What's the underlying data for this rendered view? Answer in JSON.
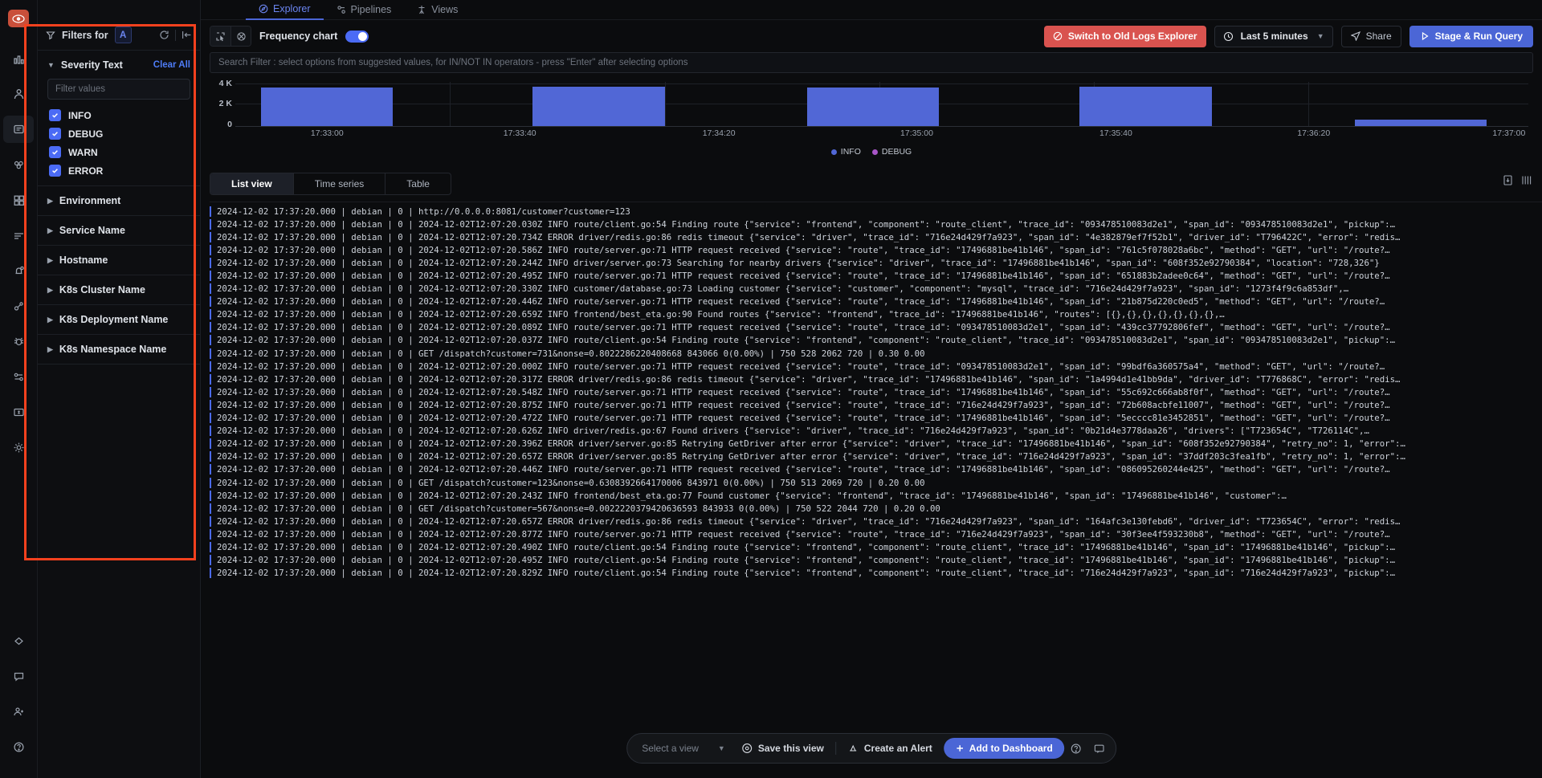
{
  "rail": {
    "logo": "signoz-logo-icon",
    "items": [
      {
        "name": "bar-chart-icon",
        "active": false
      },
      {
        "name": "traces-icon",
        "active": false
      },
      {
        "name": "logs-icon",
        "active": true
      },
      {
        "name": "services-icon",
        "active": false
      },
      {
        "name": "dashboards-icon",
        "active": false
      },
      {
        "name": "list-icon",
        "active": false
      },
      {
        "name": "alerts-bell-icon",
        "active": false
      },
      {
        "name": "exceptions-icon",
        "active": false
      },
      {
        "name": "bug-icon",
        "active": false
      },
      {
        "name": "pipelines-icon",
        "active": false
      },
      {
        "name": "billing-icon",
        "active": false
      },
      {
        "name": "settings-gear-icon",
        "active": false
      }
    ],
    "bottom_items": [
      {
        "name": "integrations-icon"
      },
      {
        "name": "support-chat-icon"
      },
      {
        "name": "invite-members-icon"
      },
      {
        "name": "help-icon"
      }
    ]
  },
  "top_tabs": [
    {
      "label": "Explorer",
      "icon": "compass-icon",
      "selected": true
    },
    {
      "label": "Pipelines",
      "icon": "pipelines-icon",
      "selected": false
    },
    {
      "label": "Views",
      "icon": "views-icon",
      "selected": false
    }
  ],
  "filters": {
    "title": "Filters for",
    "chip": "A",
    "sync_icon": "refresh-icon",
    "collapse_icon": "collapse-panel-icon",
    "sections": [
      {
        "label": "Severity Text",
        "expanded": true,
        "clear_all": "Clear All",
        "input_placeholder": "Filter values",
        "options": [
          {
            "label": "INFO",
            "checked": true
          },
          {
            "label": "DEBUG",
            "checked": true
          },
          {
            "label": "WARN",
            "checked": true
          },
          {
            "label": "ERROR",
            "checked": true
          }
        ]
      },
      {
        "label": "Environment",
        "expanded": false
      },
      {
        "label": "Service Name",
        "expanded": false
      },
      {
        "label": "Hostname",
        "expanded": false
      },
      {
        "label": "K8s Cluster Name",
        "expanded": false
      },
      {
        "label": "K8s Deployment Name",
        "expanded": false
      },
      {
        "label": "K8s Namespace Name",
        "expanded": false
      }
    ]
  },
  "toolbar": {
    "select_icon": "cursor-select-icon",
    "lasso_icon": "lasso-select-icon",
    "frequency_label": "Frequency chart",
    "frequency_on": true,
    "switch_old": "Switch to Old Logs Explorer",
    "switch_old_icon": "slash-circle-icon",
    "time_range": "Last 5 minutes",
    "time_icon": "clock-icon",
    "share": "Share",
    "share_icon": "send-icon",
    "run_query": "Stage & Run Query",
    "run_icon": "play-icon",
    "accent_blue": "#4b66d6",
    "danger_red": "#d9534f"
  },
  "search": {
    "placeholder": "Search Filter : select options from suggested values, for IN/NOT IN operators - press \"Enter\" after selecting options"
  },
  "chart_data": {
    "type": "bar",
    "title": "",
    "xlabel": "",
    "ylabel": "",
    "ylim": [
      0,
      4000
    ],
    "yticks": [
      "0",
      "2 K",
      "4 K"
    ],
    "ytick_values": [
      0,
      2000,
      4000
    ],
    "grid": true,
    "legend_position": "bottom",
    "xticks": [
      "17:33:00",
      "17:33:40",
      "17:34:20",
      "17:35:00",
      "17:35:40",
      "17:36:20",
      "17:37:00"
    ],
    "series": [
      {
        "name": "INFO",
        "color": "#5167d6",
        "bars": [
          {
            "x": "17:33:00",
            "value": 3400
          },
          {
            "x": "17:33:40",
            "value": 3450
          },
          {
            "x": "17:34:40",
            "value": 3400
          },
          {
            "x": "17:35:40",
            "value": 3450
          },
          {
            "x": "17:36:50",
            "value": 500
          }
        ]
      },
      {
        "name": "DEBUG",
        "color": "#a855c7",
        "bars": []
      }
    ],
    "legend": [
      {
        "label": "INFO",
        "color": "#5167d6"
      },
      {
        "label": "DEBUG",
        "color": "#a855c7"
      }
    ]
  },
  "view_tabs": [
    {
      "label": "List view",
      "selected": true
    },
    {
      "label": "Time series",
      "selected": false
    },
    {
      "label": "Table",
      "selected": false
    }
  ],
  "view_actions": [
    {
      "name": "download-icon"
    },
    {
      "name": "column-settings-icon"
    }
  ],
  "logs": [
    "2024-12-02 17:37:20.000 | debian | 0 | http://0.0.0.0:8081/customer?customer=123",
    "2024-12-02 17:37:20.000 | debian | 0 | 2024-12-02T12:07:20.030Z INFO route/client.go:54 Finding route {\"service\": \"frontend\", \"component\": \"route_client\", \"trace_id\": \"093478510083d2e1\", \"span_id\": \"093478510083d2e1\", \"pickup\":…",
    "2024-12-02 17:37:20.000 | debian | 0 | 2024-12-02T12:07:20.734Z ERROR driver/redis.go:86 redis timeout {\"service\": \"driver\", \"trace_id\": \"716e24d429f7a923\", \"span_id\": \"4e382879ef7f52b1\", \"driver_id\": \"T796422C\", \"error\": \"redis…",
    "2024-12-02 17:37:20.000 | debian | 0 | 2024-12-02T12:07:20.586Z INFO route/server.go:71 HTTP request received {\"service\": \"route\", \"trace_id\": \"17496881be41b146\", \"span_id\": \"761c5f078028a6bc\", \"method\": \"GET\", \"url\": \"/route?…",
    "2024-12-02 17:37:20.000 | debian | 0 | 2024-12-02T12:07:20.244Z INFO driver/server.go:73 Searching for nearby drivers {\"service\": \"driver\", \"trace_id\": \"17496881be41b146\", \"span_id\": \"608f352e92790384\", \"location\": \"728,326\"}",
    "2024-12-02 17:37:20.000 | debian | 0 | 2024-12-02T12:07:20.495Z INFO route/server.go:71 HTTP request received {\"service\": \"route\", \"trace_id\": \"17496881be41b146\", \"span_id\": \"651883b2adee0c64\", \"method\": \"GET\", \"url\": \"/route?…",
    "2024-12-02 17:37:20.000 | debian | 0 | 2024-12-02T12:07:20.330Z INFO customer/database.go:73 Loading customer {\"service\": \"customer\", \"component\": \"mysql\", \"trace_id\": \"716e24d429f7a923\", \"span_id\": \"1273f4f9c6a853df\",…",
    "2024-12-02 17:37:20.000 | debian | 0 | 2024-12-02T12:07:20.446Z INFO route/server.go:71 HTTP request received {\"service\": \"route\", \"trace_id\": \"17496881be41b146\", \"span_id\": \"21b875d220c0ed5\", \"method\": \"GET\", \"url\": \"/route?…",
    "2024-12-02 17:37:20.000 | debian | 0 | 2024-12-02T12:07:20.659Z INFO frontend/best_eta.go:90 Found routes {\"service\": \"frontend\", \"trace_id\": \"17496881be41b146\", \"routes\": [{},{},{},{},{},{},{},…",
    "2024-12-02 17:37:20.000 | debian | 0 | 2024-12-02T12:07:20.089Z INFO route/server.go:71 HTTP request received {\"service\": \"route\", \"trace_id\": \"093478510083d2e1\", \"span_id\": \"439cc37792806fef\", \"method\": \"GET\", \"url\": \"/route?…",
    "2024-12-02 17:37:20.000 | debian | 0 | 2024-12-02T12:07:20.037Z INFO route/client.go:54 Finding route {\"service\": \"frontend\", \"component\": \"route_client\", \"trace_id\": \"093478510083d2e1\", \"span_id\": \"093478510083d2e1\", \"pickup\":…",
    "2024-12-02 17:37:20.000 | debian | 0 | GET /dispatch?customer=731&nonse=0.8022286220408668 843066 0(0.00%) | 750 528 2062 720 | 0.30 0.00",
    "2024-12-02 17:37:20.000 | debian | 0 | 2024-12-02T12:07:20.000Z INFO route/server.go:71 HTTP request received {\"service\": \"route\", \"trace_id\": \"093478510083d2e1\", \"span_id\": \"99bdf6a360575a4\", \"method\": \"GET\", \"url\": \"/route?…",
    "2024-12-02 17:37:20.000 | debian | 0 | 2024-12-02T12:07:20.317Z ERROR driver/redis.go:86 redis timeout {\"service\": \"driver\", \"trace_id\": \"17496881be41b146\", \"span_id\": \"1a4994d1e41bb9da\", \"driver_id\": \"T776868C\", \"error\": \"redis…",
    "2024-12-02 17:37:20.000 | debian | 0 | 2024-12-02T12:07:20.548Z INFO route/server.go:71 HTTP request received {\"service\": \"route\", \"trace_id\": \"17496881be41b146\", \"span_id\": \"55c692c666ab8f0f\", \"method\": \"GET\", \"url\": \"/route?…",
    "2024-12-02 17:37:20.000 | debian | 0 | 2024-12-02T12:07:20.875Z INFO route/server.go:71 HTTP request received {\"service\": \"route\", \"trace_id\": \"716e24d429f7a923\", \"span_id\": \"72b608acbfe11007\", \"method\": \"GET\", \"url\": \"/route?…",
    "2024-12-02 17:37:20.000 | debian | 0 | 2024-12-02T12:07:20.472Z INFO route/server.go:71 HTTP request received {\"service\": \"route\", \"trace_id\": \"17496881be41b146\", \"span_id\": \"5ecccc81e3452851\", \"method\": \"GET\", \"url\": \"/route?…",
    "2024-12-02 17:37:20.000 | debian | 0 | 2024-12-02T12:07:20.626Z INFO driver/redis.go:67 Found drivers {\"service\": \"driver\", \"trace_id\": \"716e24d429f7a923\", \"span_id\": \"0b21d4e3778daa26\", \"drivers\": [\"T723654C\", \"T726114C\",…",
    "2024-12-02 17:37:20.000 | debian | 0 | 2024-12-02T12:07:20.396Z ERROR driver/server.go:85 Retrying GetDriver after error {\"service\": \"driver\", \"trace_id\": \"17496881be41b146\", \"span_id\": \"608f352e92790384\", \"retry_no\": 1, \"error\":…",
    "2024-12-02 17:37:20.000 | debian | 0 | 2024-12-02T12:07:20.657Z ERROR driver/server.go:85 Retrying GetDriver after error {\"service\": \"driver\", \"trace_id\": \"716e24d429f7a923\", \"span_id\": \"37ddf203c3fea1fb\", \"retry_no\": 1, \"error\":…",
    "2024-12-02 17:37:20.000 | debian | 0 | 2024-12-02T12:07:20.446Z INFO route/server.go:71 HTTP request received {\"service\": \"route\", \"trace_id\": \"17496881be41b146\", \"span_id\": \"086095260244e425\", \"method\": \"GET\", \"url\": \"/route?…",
    "2024-12-02 17:37:20.000 | debian | 0 | GET /dispatch?customer=123&nonse=0.6308392664170006 843971 0(0.00%) | 750 513 2069 720 | 0.20 0.00",
    "2024-12-02 17:37:20.000 | debian | 0 | 2024-12-02T12:07:20.243Z INFO frontend/best_eta.go:77 Found customer {\"service\": \"frontend\", \"trace_id\": \"17496881be41b146\", \"span_id\": \"17496881be41b146\", \"customer\":…",
    "2024-12-02 17:37:20.000 | debian | 0 | GET /dispatch?customer=567&nonse=0.0022220379420636593 843933 0(0.00%) | 750 522 2044 720 | 0.20 0.00",
    "2024-12-02 17:37:20.000 | debian | 0 | 2024-12-02T12:07:20.657Z ERROR driver/redis.go:86 redis timeout {\"service\": \"driver\", \"trace_id\": \"716e24d429f7a923\", \"span_id\": \"164afc3e130febd6\", \"driver_id\": \"T723654C\", \"error\": \"redis…",
    "2024-12-02 17:37:20.000 | debian | 0 | 2024-12-02T12:07:20.877Z INFO route/server.go:71 HTTP request received {\"service\": \"route\", \"trace_id\": \"716e24d429f7a923\", \"span_id\": \"30f3ee4f593230b8\", \"method\": \"GET\", \"url\": \"/route?…",
    "2024-12-02 17:37:20.000 | debian | 0 | 2024-12-02T12:07:20.490Z INFO route/client.go:54 Finding route {\"service\": \"frontend\", \"component\": \"route_client\", \"trace_id\": \"17496881be41b146\", \"span_id\": \"17496881be41b146\", \"pickup\":…",
    "2024-12-02 17:37:20.000 | debian | 0 | 2024-12-02T12:07:20.495Z INFO route/client.go:54 Finding route {\"service\": \"frontend\", \"component\": \"route_client\", \"trace_id\": \"17496881be41b146\", \"span_id\": \"17496881be41b146\", \"pickup\":…",
    "2024-12-02 17:37:20.000 | debian | 0 | 2024-12-02T12:07:20.829Z INFO route/client.go:54 Finding route {\"service\": \"frontend\", \"component\": \"route_client\", \"trace_id\": \"716e24d429f7a923\", \"span_id\": \"716e24d429f7a923\", \"pickup\":…"
  ],
  "dock": {
    "select_view_placeholder": "Select a view",
    "save_view": "Save this view",
    "save_icon": "save-disc-icon",
    "create_alert": "Create an Alert",
    "alert_icon": "alert-bell-icon",
    "add_dashboard": "Add to Dashboard",
    "add_icon": "plus-icon",
    "help_icon": "question-circle-icon",
    "feedback_icon": "feedback-icon"
  }
}
